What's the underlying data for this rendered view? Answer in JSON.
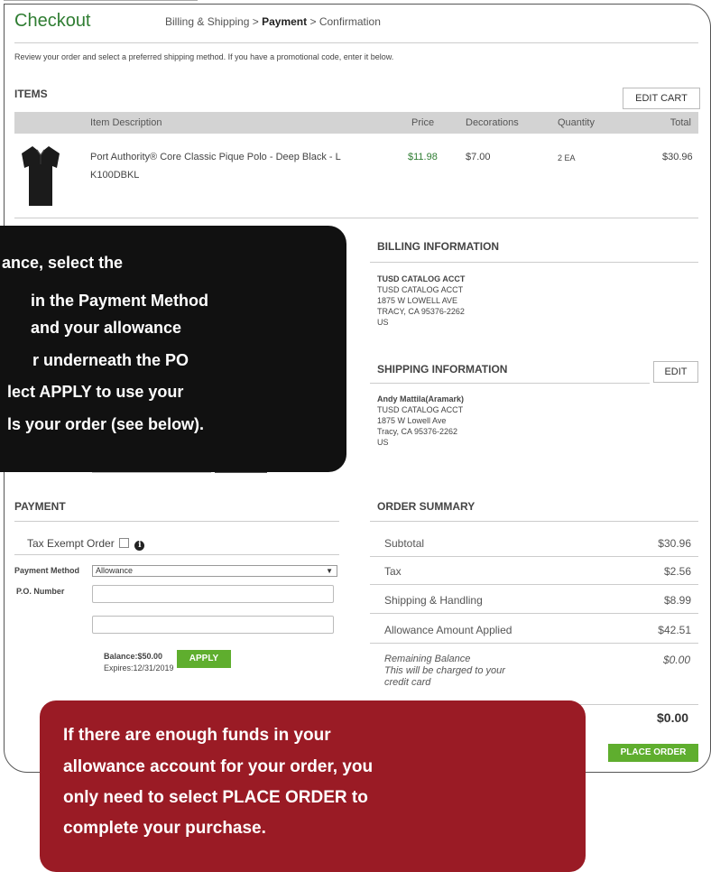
{
  "header": {
    "title": "Checkout",
    "breadcrumb": {
      "step1": "Billing & Shipping",
      "sep1": ">",
      "step2": "Payment",
      "sep2": ">",
      "step3": "Confirmation"
    }
  },
  "intro_text": "Review your order and select a preferred shipping method. If you have a promotional code, enter it below.",
  "items": {
    "heading": "ITEMS",
    "edit_cart_label": "EDIT CART",
    "columns": [
      "Item Description",
      "Price",
      "Decorations",
      "Quantity",
      "Total"
    ],
    "rows": [
      {
        "description": "Port Authority® Core Classic Pique Polo - Deep Black - L",
        "sku": "K100DBKL",
        "price": "$11.98",
        "decorations": "$7.00",
        "quantity": "2 EA",
        "total": "$30.96"
      }
    ]
  },
  "billing": {
    "heading": "BILLING INFORMATION",
    "line1": "TUSD CATALOG ACCT",
    "line2": "TUSD CATALOG ACCT",
    "line3": "1875 W LOWELL AVE",
    "line4": "TRACY, CA 95376-2262",
    "line5": "US"
  },
  "shipping": {
    "heading": "SHIPPING INFORMATION",
    "edit_label": "EDIT",
    "line1": "Andy Mattila(Aramark)",
    "line2": "TUSD CATALOG ACCT",
    "line3": "1875 W Lowell Ave",
    "line4": "Tracy, CA 95376-2262",
    "line5": "US"
  },
  "payment": {
    "heading": "PAYMENT",
    "tax_exempt_label": "Tax Exempt Order",
    "method_label": "Payment Method",
    "method_value": "Allowance",
    "po_label": "P.O. Number",
    "balance": "Balance:$50.00",
    "expires": "Expires:12/31/2019",
    "apply_label": "APPLY"
  },
  "summary": {
    "heading": "ORDER SUMMARY",
    "subtotal_label": "Subtotal",
    "subtotal": "$30.96",
    "tax_label": "Tax",
    "tax": "$2.56",
    "shipping_label": "Shipping & Handling",
    "shipping": "$8.99",
    "allowance_label": "Allowance Amount Applied",
    "allowance": "$42.51",
    "remaining_label1": "Remaining Balance",
    "remaining_label2": "This will be charged to your",
    "remaining_label3": "credit card",
    "remaining": "$0.00",
    "total": "$0.00",
    "place_order_label": "PLACE ORDER"
  },
  "callouts": {
    "black": {
      "line1": "ance, select the",
      "line2": "in the Payment Method",
      "line3": "and your allowance",
      "line4": "r underneath the PO",
      "line5": "lect APPLY to use your",
      "line6": "ls your order (see below)."
    },
    "red": {
      "line1": "If there are enough funds in your",
      "line2": "allowance account for your order, you",
      "line3": "only need to select PLACE ORDER to",
      "line4": "complete your purchase."
    }
  },
  "colors": {
    "brand_green": "#2f7d32",
    "button_green": "#5fae2e",
    "callout_black": "#111111",
    "callout_red": "#9a1b25"
  }
}
